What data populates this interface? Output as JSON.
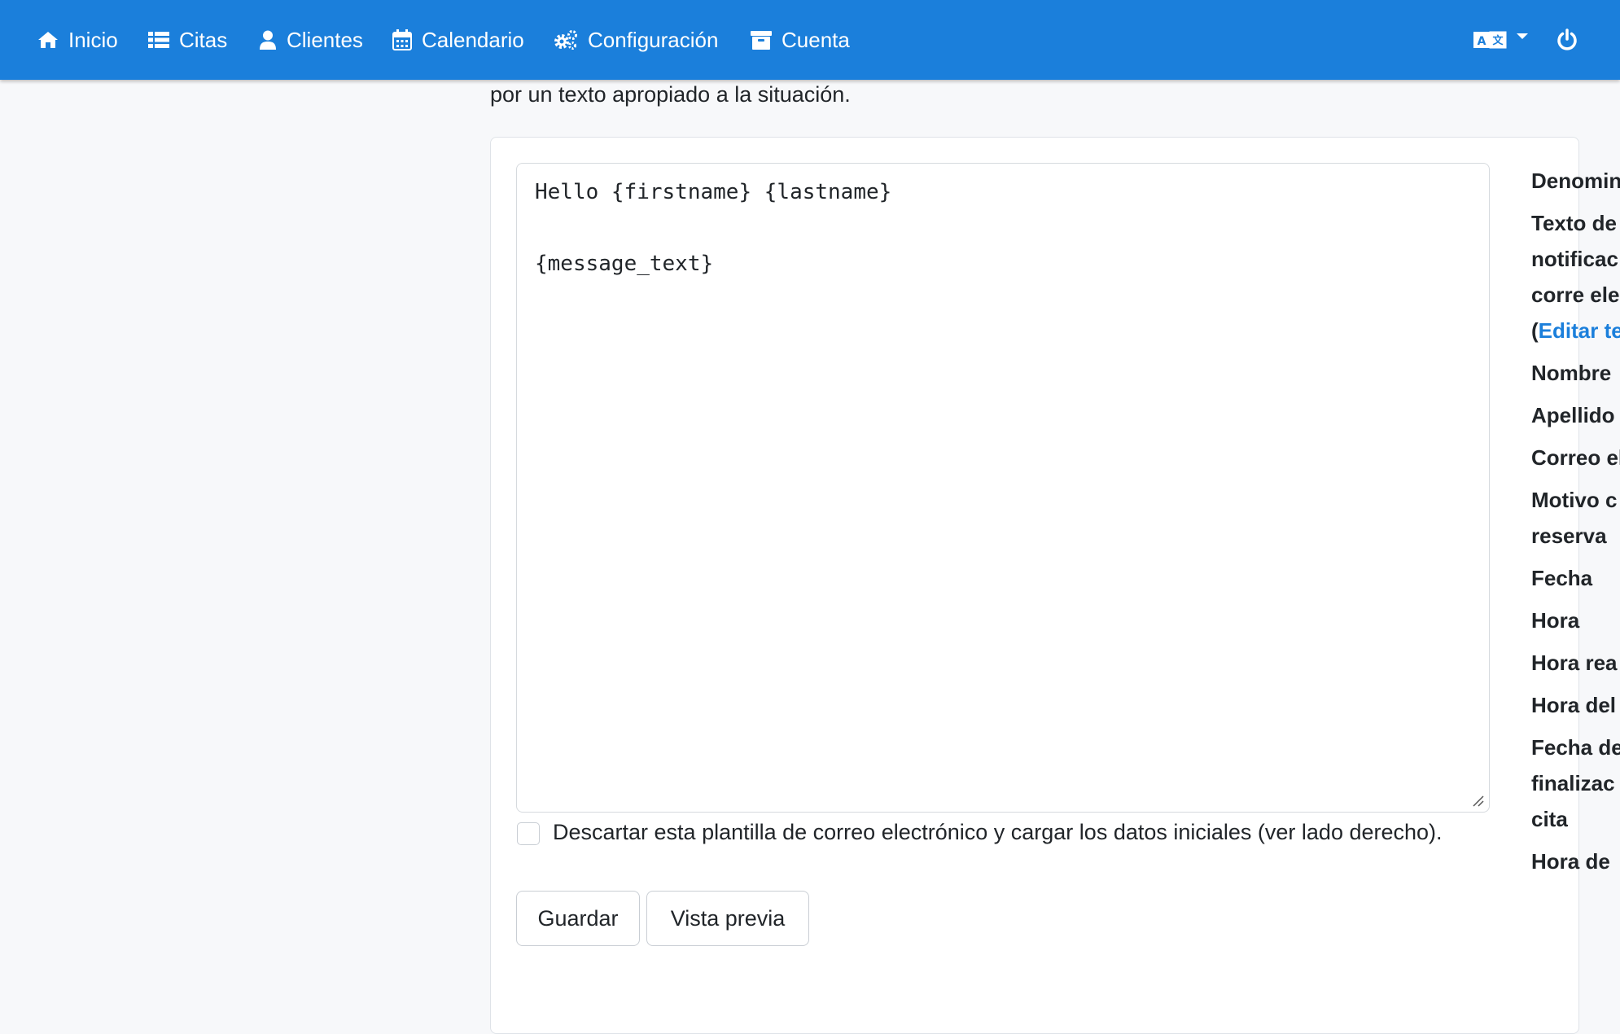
{
  "nav": {
    "items": [
      {
        "label": "Inicio",
        "icon": "home-icon"
      },
      {
        "label": "Citas",
        "icon": "list-icon"
      },
      {
        "label": "Clientes",
        "icon": "user-icon"
      },
      {
        "label": "Calendario",
        "icon": "calendar-icon"
      },
      {
        "label": "Configuración",
        "icon": "gears-icon"
      },
      {
        "label": "Cuenta",
        "icon": "archive-icon"
      }
    ],
    "language_icon": "language-icon",
    "logout_icon": "power-icon"
  },
  "intro_text": "por un texto apropiado a la situación.",
  "editor": {
    "lines": [
      "Hello {firstname} {lastname}",
      "",
      "{message_text}"
    ]
  },
  "discard": {
    "label": "Descartar esta plantilla de correo electrónico y cargar los datos iniciales (ver lado derecho)."
  },
  "buttons": {
    "save": "Guardar",
    "preview": "Vista previa"
  },
  "sidebar": {
    "items": [
      {
        "label": "Denomin"
      },
      {
        "label": "Texto de notificac por corre electrón",
        "link_prefix": "(",
        "link": "Editar te"
      },
      {
        "label": "Nombre"
      },
      {
        "label": "Apellido"
      },
      {
        "label": "Correo electrón"
      },
      {
        "label": "Motivo c reserva"
      },
      {
        "label": "Fecha"
      },
      {
        "label": "Hora"
      },
      {
        "label": "Hora rea"
      },
      {
        "label": "Hora del cliente"
      },
      {
        "label": "Fecha de finalizac de la cita"
      },
      {
        "label": "Hora de"
      }
    ]
  },
  "colors": {
    "navbar": "#1b7fdb",
    "link": "#1b7fdb"
  }
}
